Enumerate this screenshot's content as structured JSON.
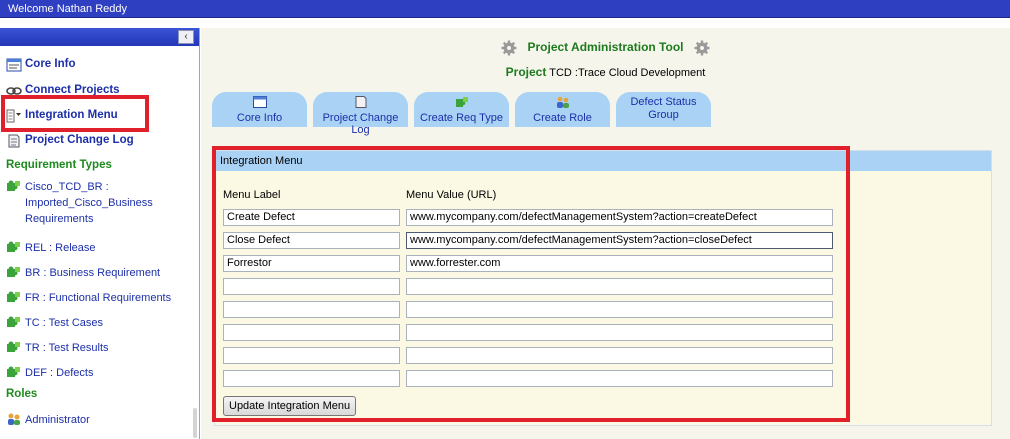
{
  "header": {
    "welcome": "Welcome Nathan Reddy"
  },
  "sidebar": {
    "collapse_glyph": "‹",
    "nav": [
      {
        "label": "Core Info",
        "icon": "window-icon"
      },
      {
        "label": "Connect Projects",
        "icon": "link-icon"
      },
      {
        "label": "Integration Menu",
        "icon": "menu-icon"
      },
      {
        "label": "Project Change Log",
        "icon": "document-icon"
      }
    ],
    "requirement_types_heading": "Requirement Types",
    "requirement_types": [
      "Cisco_TCD_BR : Imported_Cisco_Business Requirements",
      "REL : Release",
      "BR : Business Requirement",
      "FR : Functional Requirements",
      "TC : Test Cases",
      "TR : Test Results",
      "DEF : Defects"
    ],
    "roles_heading": "Roles",
    "roles": [
      "Administrator"
    ]
  },
  "main": {
    "title": "Project Administration Tool",
    "project_label": "Project",
    "project_value": "TCD :Trace Cloud Development",
    "tabs": [
      {
        "label": "Core Info",
        "icon": "window-icon"
      },
      {
        "label": "Project Change Log",
        "icon": "document-icon"
      },
      {
        "label": "Create Req Type",
        "icon": "puzzle-icon"
      },
      {
        "label": "Create Role",
        "icon": "users-icon"
      },
      {
        "label": "Defect Status Group",
        "icon": ""
      }
    ],
    "panel": {
      "title": "Integration Menu",
      "col_label": "Menu Label",
      "col_value": "Menu Value (URL)",
      "rows": [
        {
          "label": "Create Defect",
          "value": "www.mycompany.com/defectManagementSystem?action=createDefect"
        },
        {
          "label": "Close Defect",
          "value": "www.mycompany.com/defectManagementSystem?action=closeDefect"
        },
        {
          "label": "Forrestor",
          "value": "www.forrester.com"
        },
        {
          "label": "",
          "value": ""
        },
        {
          "label": "",
          "value": ""
        },
        {
          "label": "",
          "value": ""
        },
        {
          "label": "",
          "value": ""
        },
        {
          "label": "",
          "value": ""
        }
      ],
      "update_button": "Update Integration Menu"
    }
  },
  "colors": {
    "topbar": "#2f3fc2",
    "link": "#1c2fa8",
    "heading_green": "#1e8a1e",
    "tab": "#a9d2f5",
    "highlight": "#e0202a"
  }
}
